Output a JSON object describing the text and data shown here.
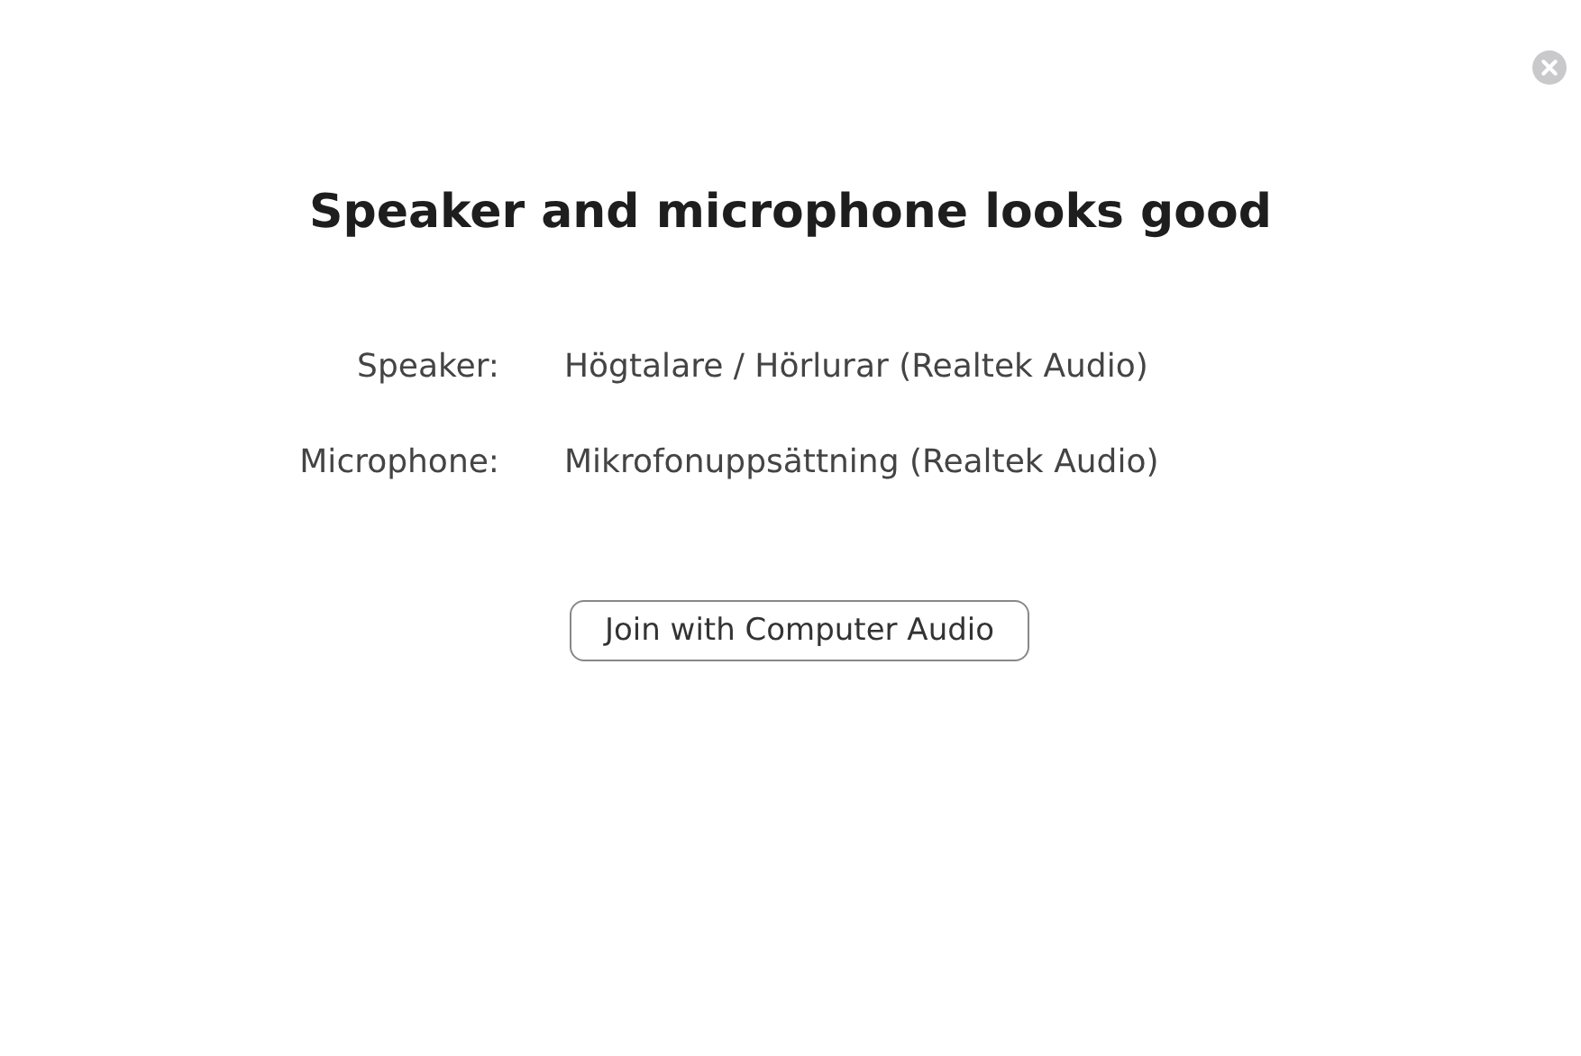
{
  "title": "Speaker and microphone looks good",
  "devices": [
    {
      "label": "Speaker:",
      "value": "Högtalare / Hörlurar (Realtek Audio)"
    },
    {
      "label": "Microphone:",
      "value": "Mikrofonuppsättning (Realtek Audio)"
    }
  ],
  "button": "Join with Computer Audio"
}
